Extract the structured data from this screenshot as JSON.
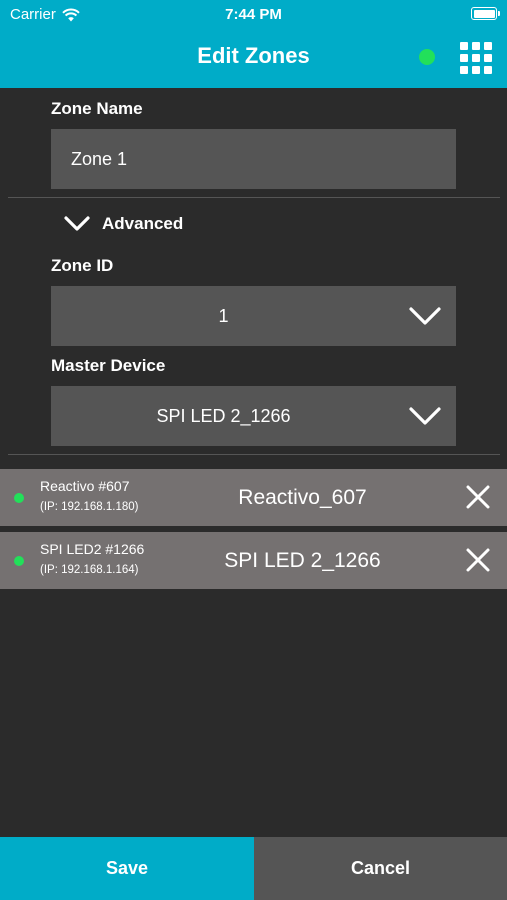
{
  "status_bar": {
    "carrier": "Carrier",
    "time": "7:44 PM"
  },
  "header": {
    "title": "Edit Zones",
    "connection_color": "#22e05a"
  },
  "zone_name": {
    "label": "Zone Name",
    "value": "Zone 1"
  },
  "advanced": {
    "label": "Advanced",
    "expanded": true
  },
  "zone_id": {
    "label": "Zone ID",
    "value": "1"
  },
  "master_device": {
    "label": "Master Device",
    "value": "SPI LED 2_1266"
  },
  "devices": [
    {
      "name": "Reactivo #607",
      "ip": "(IP: 192.168.1.180)",
      "display_name": "Reactivo_607",
      "status_color": "#22e05a"
    },
    {
      "name": "SPI LED2 #1266",
      "ip": "(IP: 192.168.1.164)",
      "display_name": "SPI LED 2_1266",
      "status_color": "#22e05a"
    }
  ],
  "footer": {
    "save_label": "Save",
    "cancel_label": "Cancel"
  },
  "colors": {
    "accent": "#00acc8",
    "background": "#2b2b2b",
    "field": "#555555",
    "device_row": "#757171"
  }
}
